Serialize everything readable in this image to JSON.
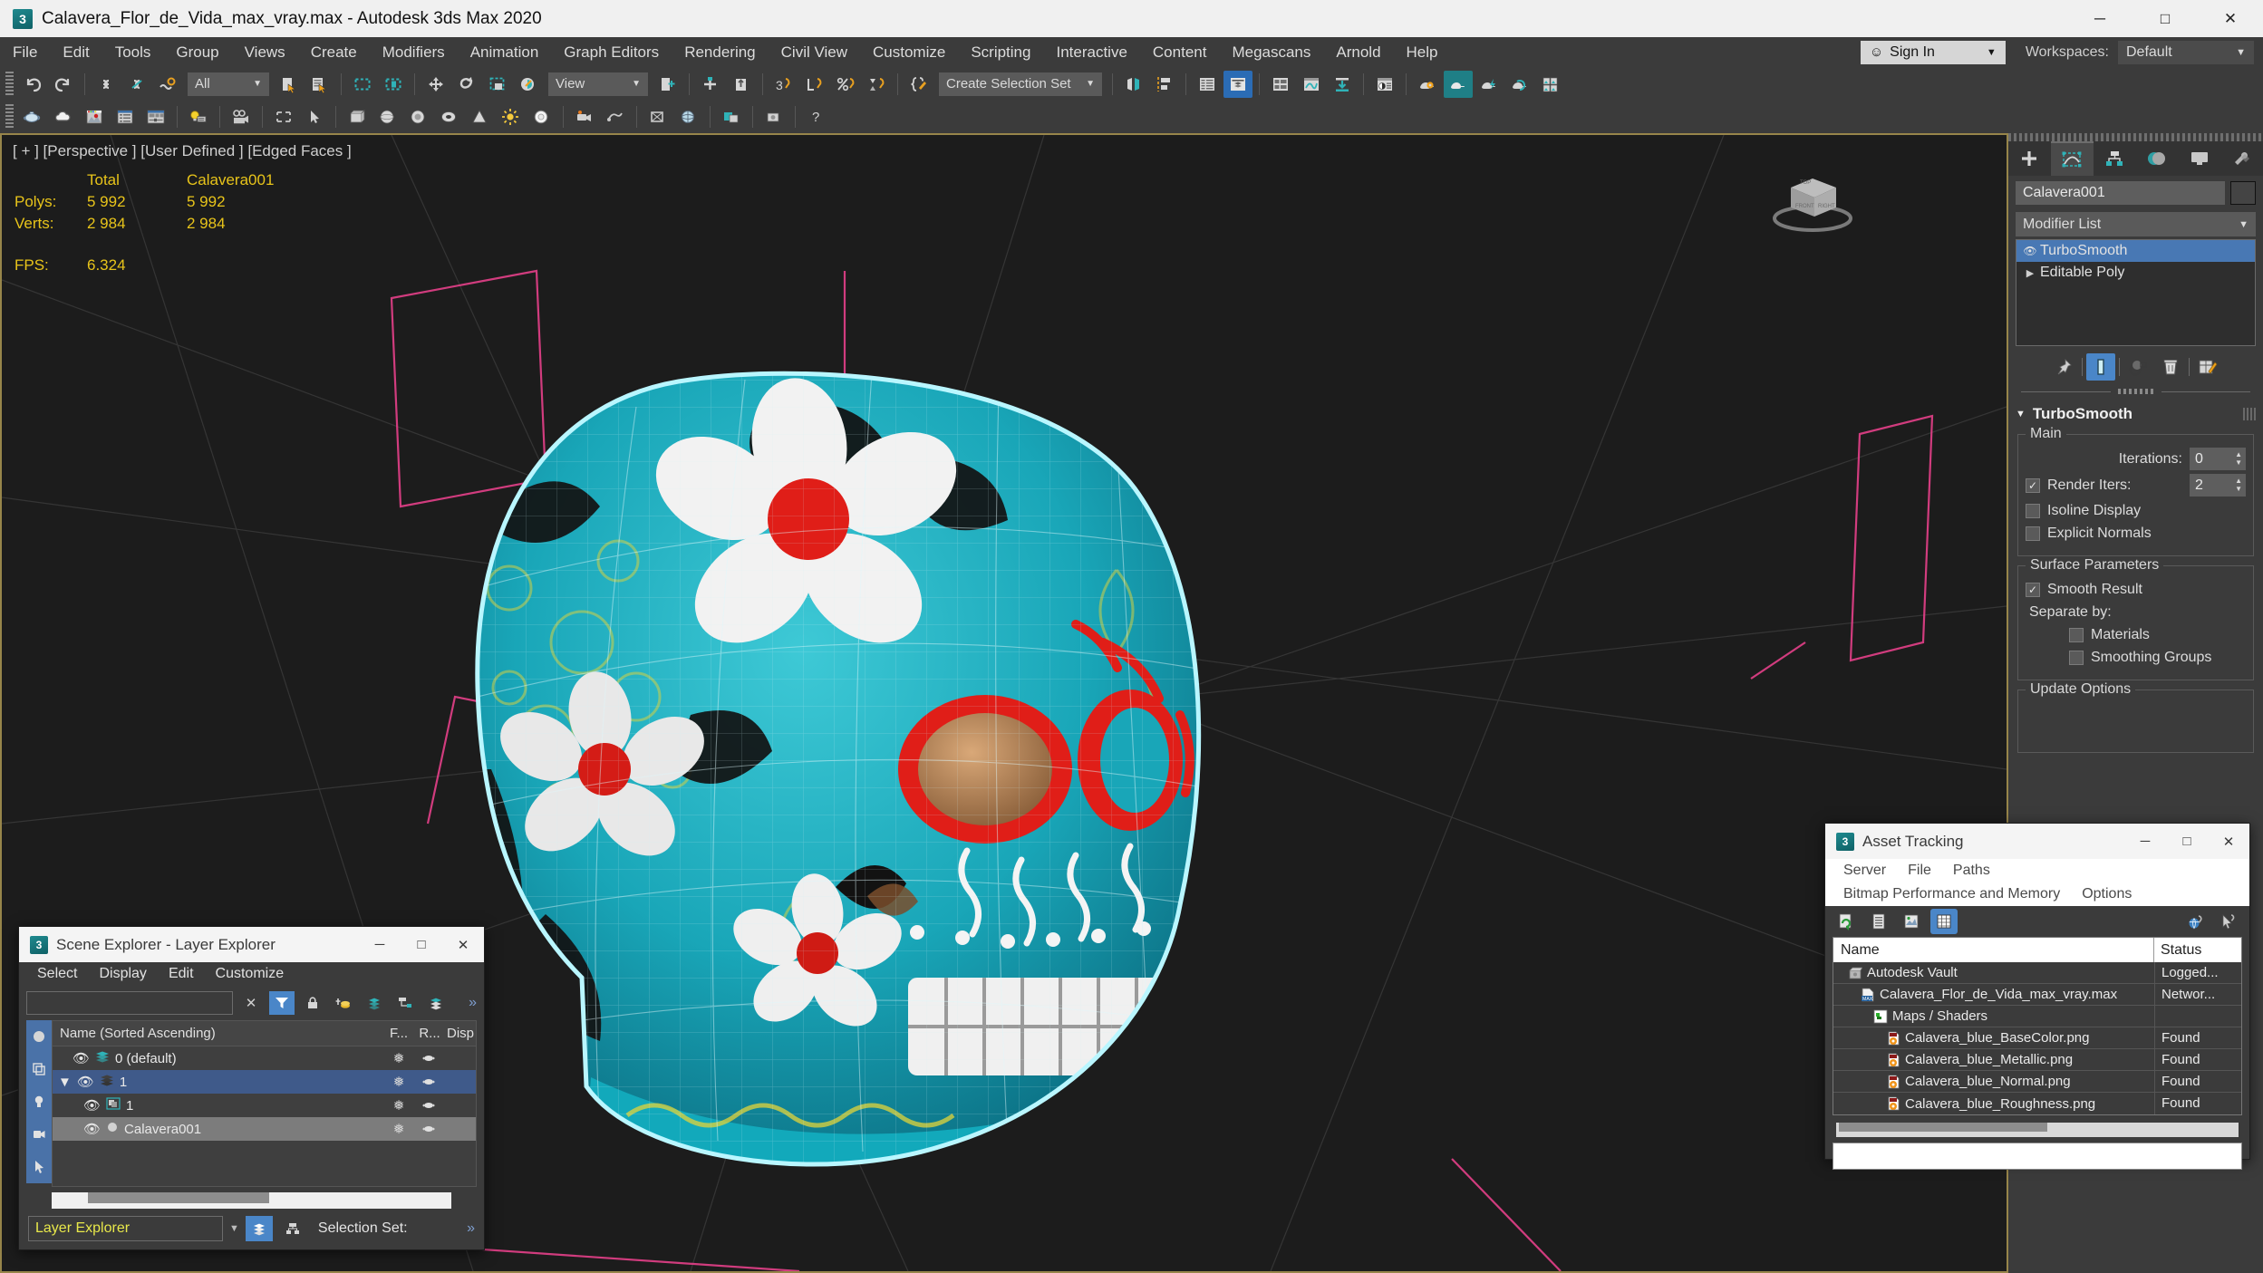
{
  "titlebar": {
    "app_icon": "3dsmax-icon",
    "title": "Calavera_Flor_de_Vida_max_vray.max - Autodesk 3ds Max 2020",
    "minimize": "─",
    "maximize": "□",
    "close": "✕"
  },
  "menubar": {
    "items": [
      "File",
      "Edit",
      "Tools",
      "Group",
      "Views",
      "Create",
      "Modifiers",
      "Animation",
      "Graph Editors",
      "Rendering",
      "Civil View",
      "Customize",
      "Scripting",
      "Interactive",
      "Content",
      "Megascans",
      "Arnold",
      "Help"
    ],
    "sign_in": "Sign In",
    "workspaces_label": "Workspaces:",
    "workspace_value": "Default",
    "caret": "▼"
  },
  "toolbar": {
    "selection_filter": "All",
    "reference_coord": "View",
    "selection_set": "Create Selection Set",
    "caret": "▼"
  },
  "viewport": {
    "label": "[ + ] [Perspective ] [User Defined ] [Edged Faces ]",
    "stats": {
      "col_total": "Total",
      "col_object": "Calavera001",
      "rows": [
        {
          "label": "Polys:",
          "total": "5 992",
          "object": "5 992"
        },
        {
          "label": "Verts:",
          "total": "2 984",
          "object": "2 984"
        }
      ],
      "fps_label": "FPS:",
      "fps_value": "6.324"
    },
    "viewcube": "viewcube"
  },
  "command_panel": {
    "tabs": [
      {
        "name": "create-tab",
        "icon": "plus-icon"
      },
      {
        "name": "modify-tab",
        "icon": "modify-icon",
        "selected": true
      },
      {
        "name": "hierarchy-tab",
        "icon": "hierarchy-icon"
      },
      {
        "name": "motion-tab",
        "icon": "motion-icon"
      },
      {
        "name": "display-tab",
        "icon": "display-icon"
      },
      {
        "name": "utilities-tab",
        "icon": "utilities-icon"
      }
    ],
    "object_name": "Calavera001",
    "modifier_list_label": "Modifier List",
    "modifier_stack": [
      {
        "label": "TurboSmooth",
        "selected": true,
        "icon": "eye-icon"
      },
      {
        "label": "Editable Poly",
        "selected": false,
        "icon": "expand-arrow-icon"
      }
    ],
    "stack_tools": [
      {
        "name": "pin-stack-button",
        "icon": "pin-icon"
      },
      {
        "name": "show-end-result-button",
        "icon": "show-result-icon",
        "active": true
      },
      {
        "name": "make-unique-button",
        "icon": "make-unique-icon"
      },
      {
        "name": "remove-modifier-button",
        "icon": "trash-icon"
      },
      {
        "name": "configure-modifier-sets-button",
        "icon": "configure-icon"
      }
    ],
    "rollout": {
      "title": "TurboSmooth",
      "main_group": "Main",
      "iterations_label": "Iterations:",
      "iterations_value": "0",
      "render_iters_label": "Render Iters:",
      "render_iters_value": "2",
      "render_iters_checked": true,
      "isoline_display": "Isoline Display",
      "isoline_checked": false,
      "explicit_normals": "Explicit Normals",
      "explicit_checked": false,
      "surface_parameters": "Surface Parameters",
      "smooth_result": "Smooth Result",
      "smooth_checked": true,
      "separate_by": "Separate by:",
      "materials": "Materials",
      "materials_checked": false,
      "smoothing_groups": "Smoothing Groups",
      "smoothing_groups_checked": false,
      "update_options": "Update Options"
    }
  },
  "scene_explorer": {
    "title": "Scene Explorer - Layer Explorer",
    "menu": [
      "Select",
      "Display",
      "Edit",
      "Customize"
    ],
    "search_value": "",
    "columns": [
      "Name (Sorted Ascending)",
      "F...",
      "R...",
      "Disp"
    ],
    "rows": [
      {
        "name": "0 (default)",
        "indent": 1,
        "icon": "layer-icon",
        "freeze": "❅",
        "render": "teapot-icon",
        "selected": false
      },
      {
        "name": "1",
        "indent": 1,
        "icon": "layer-dark-icon",
        "freeze": "❅",
        "render": "teapot-icon",
        "selected": true
      },
      {
        "name": "1",
        "indent": 2,
        "icon": "object-icon",
        "freeze": "❅",
        "render": "teapot-icon",
        "selected": false
      },
      {
        "name": "Calavera001",
        "indent": 2,
        "icon": "mesh-icon",
        "freeze": "❅",
        "render": "teapot-icon",
        "selected2": true
      }
    ],
    "footer_value": "Layer Explorer",
    "selection_set_label": "Selection Set:",
    "minimize": "─",
    "maximize": "□",
    "close": "✕",
    "chevron": "»"
  },
  "asset_tracking": {
    "title": "Asset Tracking",
    "menu_row1": [
      "Server",
      "File",
      "Paths"
    ],
    "menu_row2": [
      "Bitmap Performance and Memory",
      "Options"
    ],
    "columns": [
      "Name",
      "Status"
    ],
    "rows": [
      {
        "name": "Autodesk Vault",
        "status": "Logged...",
        "indent": 1,
        "icon": "vault-icon"
      },
      {
        "name": "Calavera_Flor_de_Vida_max_vray.max",
        "status": "Networ...",
        "indent": 2,
        "icon": "max-file-icon"
      },
      {
        "name": "Maps / Shaders",
        "status": "",
        "indent": 3,
        "icon": "maps-icon"
      },
      {
        "name": "Calavera_blue_BaseColor.png",
        "status": "Found",
        "indent": 4,
        "icon": "png-file-icon"
      },
      {
        "name": "Calavera_blue_Metallic.png",
        "status": "Found",
        "indent": 4,
        "icon": "png-file-icon"
      },
      {
        "name": "Calavera_blue_Normal.png",
        "status": "Found",
        "indent": 4,
        "icon": "png-file-icon"
      },
      {
        "name": "Calavera_blue_Roughness.png",
        "status": "Found",
        "indent": 4,
        "icon": "png-file-icon"
      }
    ],
    "minimize": "─",
    "maximize": "□",
    "close": "✕"
  },
  "colors": {
    "accent_teal": "#2fb3b8",
    "accent_blue": "#4a86c8",
    "stats_yellow": "#e8c41a",
    "viewport_bg": "#1c1c1c",
    "panel_bg": "#3b3b3b",
    "viewport_border": "#97854a"
  }
}
